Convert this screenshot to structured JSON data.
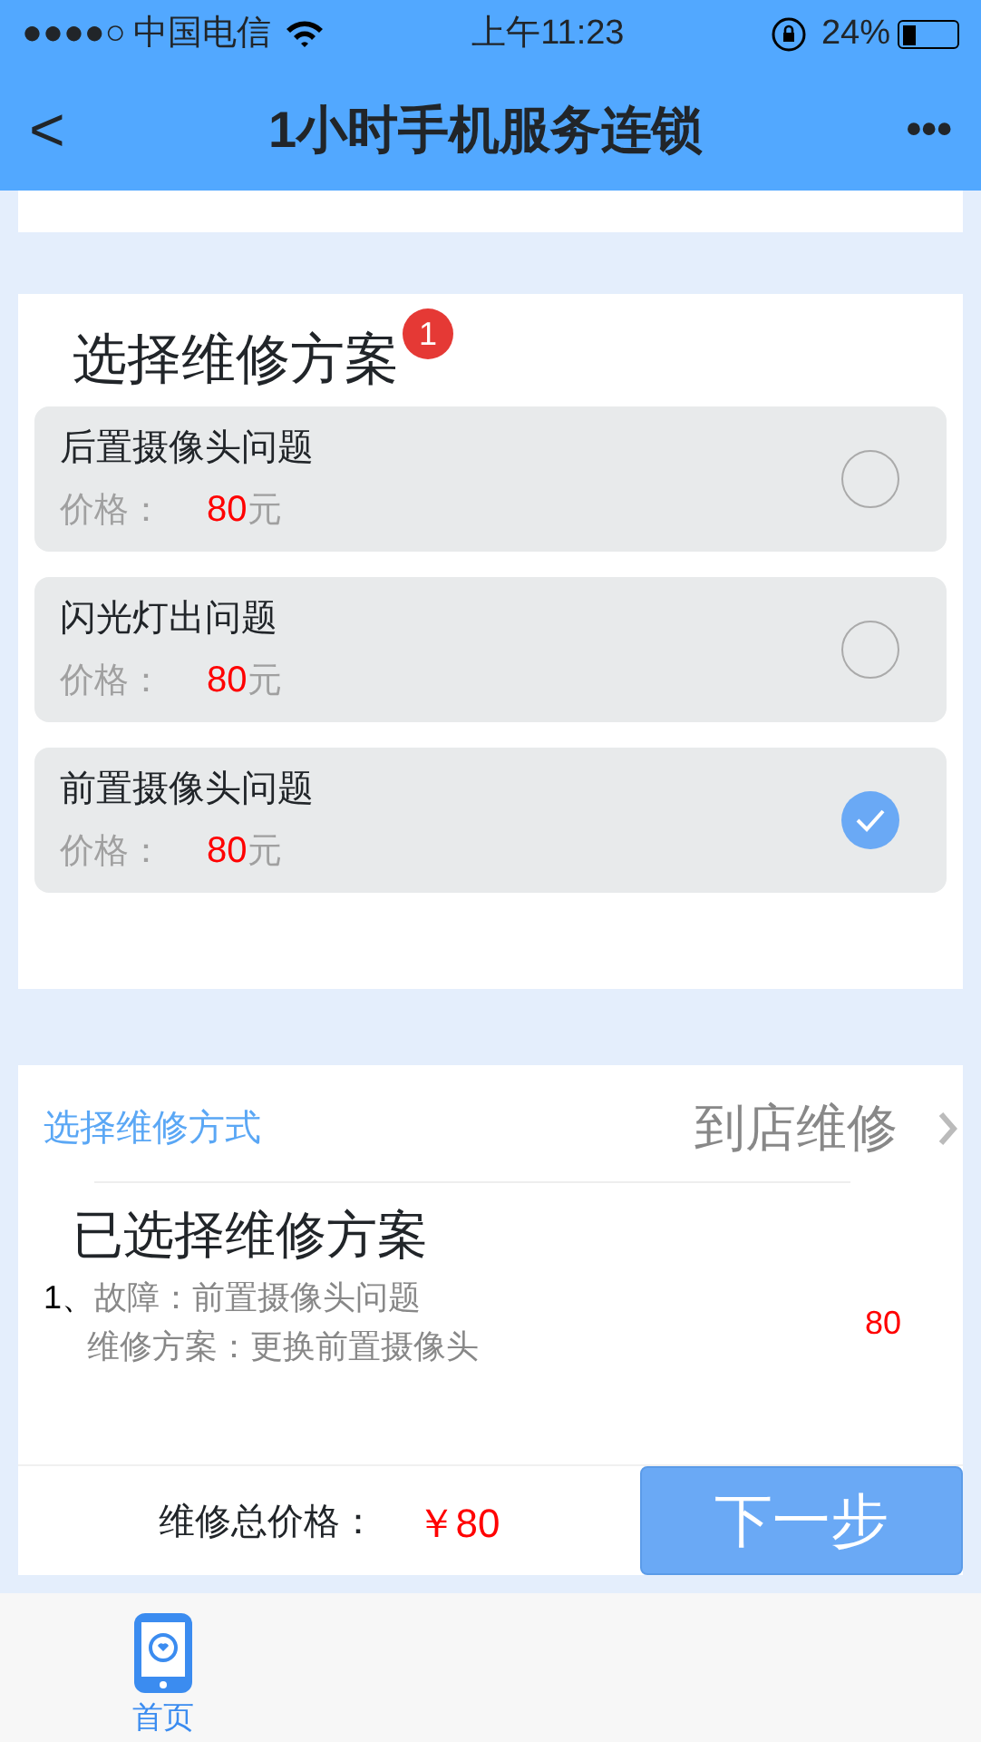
{
  "status_bar": {
    "signal": "●●●●○",
    "carrier": "中国电信",
    "time": "上午11:23",
    "battery": "24%"
  },
  "nav_bar": {
    "back": "<",
    "title": "1小时手机服务连锁",
    "more": "•••"
  },
  "plan_section": {
    "title": "选择维修方案",
    "badge": "1",
    "options": [
      {
        "name": "后置摄像头问题",
        "price_label": "价格：",
        "price": "80",
        "unit": "元",
        "selected": false
      },
      {
        "name": "闪光灯出问题",
        "price_label": "价格：",
        "price": "80",
        "unit": "元",
        "selected": false
      },
      {
        "name": "前置摄像头问题",
        "price_label": "价格：",
        "price": "80",
        "unit": "元",
        "selected": true
      }
    ]
  },
  "method": {
    "label": "选择维修方式",
    "value": "到店维修"
  },
  "summary": {
    "title": "已选择维修方案",
    "items": [
      {
        "index": "1、",
        "fault_label": "故障：",
        "fault": "前置摄像头问题",
        "plan_label": "维修方案：",
        "plan": "更换前置摄像头",
        "price": "80"
      }
    ]
  },
  "footer": {
    "total_label": "维修总价格：",
    "total": "￥80",
    "next": "下一步"
  },
  "tab_bar": [
    {
      "label": "首页",
      "selected": true
    }
  ]
}
